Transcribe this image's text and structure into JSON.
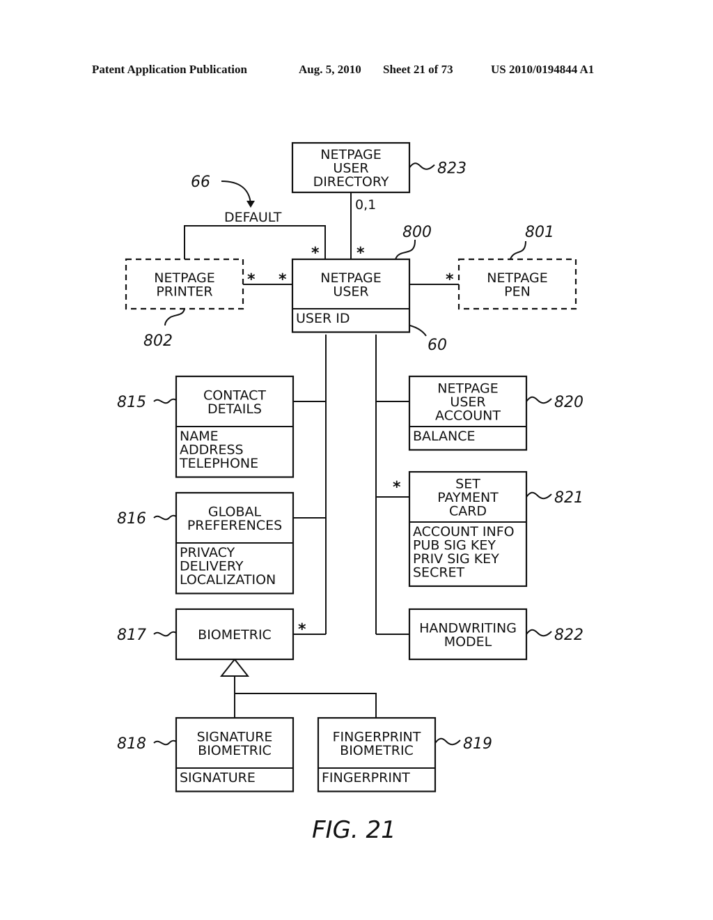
{
  "header": {
    "publication": "Patent Application Publication",
    "date": "Aug. 5, 2010",
    "sheet": "Sheet 21 of 73",
    "patent_number": "US 2010/0194844 A1"
  },
  "figure_label": "FIG. 21",
  "classes": [
    {
      "id": "user-directory",
      "name": [
        "NETPAGE",
        "USER",
        "DIRECTORY"
      ],
      "attributes": [],
      "ref": "823",
      "dashed": false
    },
    {
      "id": "user",
      "name": [
        "NETPAGE",
        "USER"
      ],
      "attributes": [
        "USER ID"
      ],
      "ref": "800",
      "dashed": false
    },
    {
      "id": "printer",
      "name": [
        "NETPAGE",
        "PRINTER"
      ],
      "attributes": [],
      "ref": "802",
      "dashed": true
    },
    {
      "id": "pen",
      "name": [
        "NETPAGE",
        "PEN"
      ],
      "attributes": [],
      "ref": "801",
      "dashed": true
    },
    {
      "id": "contact-details",
      "name": [
        "CONTACT",
        "DETAILS"
      ],
      "attributes": [
        "NAME",
        "ADDRESS",
        "TELEPHONE"
      ],
      "ref": "815",
      "dashed": false
    },
    {
      "id": "global-preferences",
      "name": [
        "GLOBAL",
        "PREFERENCES"
      ],
      "attributes": [
        "PRIVACY",
        "DELIVERY",
        "LOCALIZATION"
      ],
      "ref": "816",
      "dashed": false
    },
    {
      "id": "biometric",
      "name": [
        "BIOMETRIC"
      ],
      "attributes": [],
      "ref": "817",
      "dashed": false
    },
    {
      "id": "signature-biometric",
      "name": [
        "SIGNATURE",
        "BIOMETRIC"
      ],
      "attributes": [
        "SIGNATURE"
      ],
      "ref": "818",
      "dashed": false
    },
    {
      "id": "fingerprint-biometric",
      "name": [
        "FINGERPRINT",
        "BIOMETRIC"
      ],
      "attributes": [
        "FINGERPRINT"
      ],
      "ref": "819",
      "dashed": false
    },
    {
      "id": "user-account",
      "name": [
        "NETPAGE",
        "USER",
        "ACCOUNT"
      ],
      "attributes": [
        "BALANCE"
      ],
      "ref": "820",
      "dashed": false
    },
    {
      "id": "payment-card",
      "name": [
        "SET",
        "PAYMENT",
        "CARD"
      ],
      "attributes": [
        "ACCOUNT INFO",
        "PUB SIG KEY",
        "PRIV SIG KEY",
        "SECRET"
      ],
      "ref": "821",
      "dashed": false
    },
    {
      "id": "handwriting-model",
      "name": [
        "HANDWRITING",
        "MODEL"
      ],
      "attributes": [],
      "ref": "822",
      "dashed": false
    }
  ],
  "associations": {
    "default_label": "DEFAULT",
    "default_ref": "66",
    "directory_multiplicity": "0,1",
    "many": "*",
    "user_id_ref": "60"
  }
}
